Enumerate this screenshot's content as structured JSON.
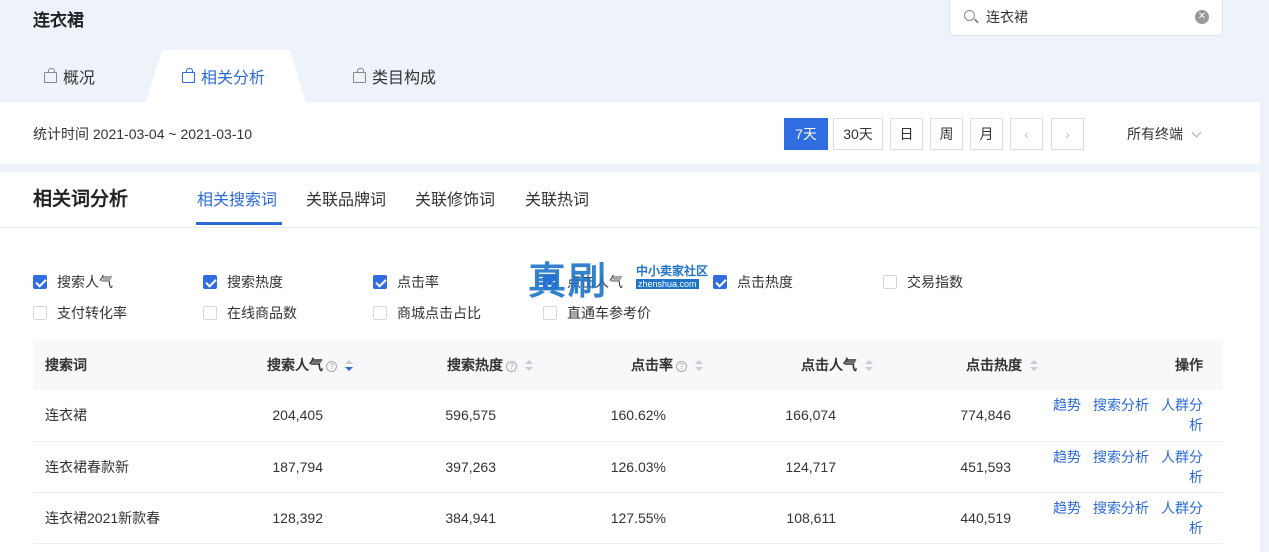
{
  "header": {
    "title": "连衣裙",
    "search": {
      "value": "连衣裙"
    }
  },
  "tabs": [
    {
      "label": "概况",
      "active": false
    },
    {
      "label": "相关分析",
      "active": true
    },
    {
      "label": "类目构成",
      "active": false
    }
  ],
  "filter": {
    "date_range": "统计时间 2021-03-04 ~ 2021-03-10",
    "period_buttons": [
      "7天",
      "30天",
      "日",
      "周",
      "月"
    ],
    "active_period": "7天",
    "terminal": "所有终端"
  },
  "analysis": {
    "title": "相关词分析",
    "subtabs": [
      "相关搜索词",
      "关联品牌词",
      "关联修饰词",
      "关联热词"
    ],
    "active_subtab": "相关搜索词"
  },
  "metrics": [
    {
      "label": "搜索人气",
      "checked": true
    },
    {
      "label": "搜索热度",
      "checked": true
    },
    {
      "label": "点击率",
      "checked": true
    },
    {
      "label": "点击人气",
      "checked": true
    },
    {
      "label": "点击热度",
      "checked": true
    },
    {
      "label": "交易指数",
      "checked": false
    },
    {
      "label": "支付转化率",
      "checked": false
    },
    {
      "label": "在线商品数",
      "checked": false
    },
    {
      "label": "商城点击占比",
      "checked": false
    },
    {
      "label": "直通车参考价",
      "checked": false
    }
  ],
  "watermark": {
    "main": "真刷",
    "sub": "中小卖家社区",
    "url": "zhenshua.com"
  },
  "table": {
    "headers": [
      "搜索词",
      "搜索人气",
      "搜索热度",
      "点击率",
      "点击人气",
      "点击热度",
      "操作"
    ],
    "rows": [
      {
        "term": "连衣裙",
        "search_pop": "204,405",
        "search_heat": "596,575",
        "ctr": "160.62%",
        "click_pop": "166,074",
        "click_heat": "774,846"
      },
      {
        "term": "连衣裙春款新",
        "search_pop": "187,794",
        "search_heat": "397,263",
        "ctr": "126.03%",
        "click_pop": "124,717",
        "click_heat": "451,593"
      },
      {
        "term": "连衣裙2021新款春",
        "search_pop": "128,392",
        "search_heat": "384,941",
        "ctr": "127.55%",
        "click_pop": "108,611",
        "click_heat": "440,519"
      }
    ],
    "actions": [
      "趋势",
      "搜索分析",
      "人群分析"
    ]
  },
  "colors": {
    "accent": "#2f6de0",
    "header_bg": "#edf2fb"
  }
}
